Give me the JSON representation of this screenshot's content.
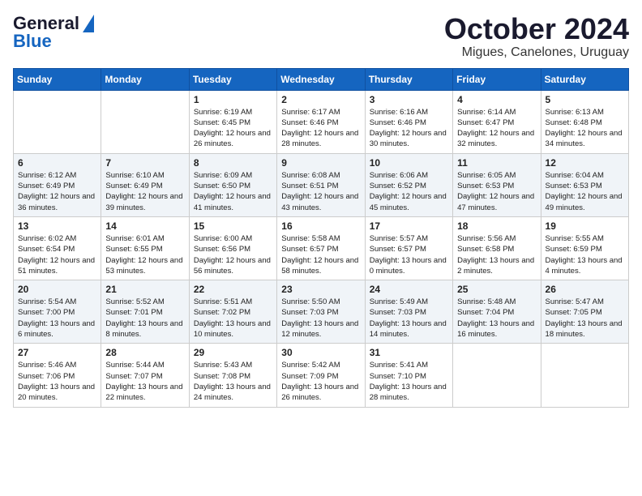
{
  "header": {
    "logo_general": "General",
    "logo_blue": "Blue",
    "month_title": "October 2024",
    "location": "Migues, Canelones, Uruguay"
  },
  "days_of_week": [
    "Sunday",
    "Monday",
    "Tuesday",
    "Wednesday",
    "Thursday",
    "Friday",
    "Saturday"
  ],
  "weeks": [
    [
      {
        "day": "",
        "sunrise": "",
        "sunset": "",
        "daylight": ""
      },
      {
        "day": "",
        "sunrise": "",
        "sunset": "",
        "daylight": ""
      },
      {
        "day": "1",
        "sunrise": "Sunrise: 6:19 AM",
        "sunset": "Sunset: 6:45 PM",
        "daylight": "Daylight: 12 hours and 26 minutes."
      },
      {
        "day": "2",
        "sunrise": "Sunrise: 6:17 AM",
        "sunset": "Sunset: 6:46 PM",
        "daylight": "Daylight: 12 hours and 28 minutes."
      },
      {
        "day": "3",
        "sunrise": "Sunrise: 6:16 AM",
        "sunset": "Sunset: 6:46 PM",
        "daylight": "Daylight: 12 hours and 30 minutes."
      },
      {
        "day": "4",
        "sunrise": "Sunrise: 6:14 AM",
        "sunset": "Sunset: 6:47 PM",
        "daylight": "Daylight: 12 hours and 32 minutes."
      },
      {
        "day": "5",
        "sunrise": "Sunrise: 6:13 AM",
        "sunset": "Sunset: 6:48 PM",
        "daylight": "Daylight: 12 hours and 34 minutes."
      }
    ],
    [
      {
        "day": "6",
        "sunrise": "Sunrise: 6:12 AM",
        "sunset": "Sunset: 6:49 PM",
        "daylight": "Daylight: 12 hours and 36 minutes."
      },
      {
        "day": "7",
        "sunrise": "Sunrise: 6:10 AM",
        "sunset": "Sunset: 6:49 PM",
        "daylight": "Daylight: 12 hours and 39 minutes."
      },
      {
        "day": "8",
        "sunrise": "Sunrise: 6:09 AM",
        "sunset": "Sunset: 6:50 PM",
        "daylight": "Daylight: 12 hours and 41 minutes."
      },
      {
        "day": "9",
        "sunrise": "Sunrise: 6:08 AM",
        "sunset": "Sunset: 6:51 PM",
        "daylight": "Daylight: 12 hours and 43 minutes."
      },
      {
        "day": "10",
        "sunrise": "Sunrise: 6:06 AM",
        "sunset": "Sunset: 6:52 PM",
        "daylight": "Daylight: 12 hours and 45 minutes."
      },
      {
        "day": "11",
        "sunrise": "Sunrise: 6:05 AM",
        "sunset": "Sunset: 6:53 PM",
        "daylight": "Daylight: 12 hours and 47 minutes."
      },
      {
        "day": "12",
        "sunrise": "Sunrise: 6:04 AM",
        "sunset": "Sunset: 6:53 PM",
        "daylight": "Daylight: 12 hours and 49 minutes."
      }
    ],
    [
      {
        "day": "13",
        "sunrise": "Sunrise: 6:02 AM",
        "sunset": "Sunset: 6:54 PM",
        "daylight": "Daylight: 12 hours and 51 minutes."
      },
      {
        "day": "14",
        "sunrise": "Sunrise: 6:01 AM",
        "sunset": "Sunset: 6:55 PM",
        "daylight": "Daylight: 12 hours and 53 minutes."
      },
      {
        "day": "15",
        "sunrise": "Sunrise: 6:00 AM",
        "sunset": "Sunset: 6:56 PM",
        "daylight": "Daylight: 12 hours and 56 minutes."
      },
      {
        "day": "16",
        "sunrise": "Sunrise: 5:58 AM",
        "sunset": "Sunset: 6:57 PM",
        "daylight": "Daylight: 12 hours and 58 minutes."
      },
      {
        "day": "17",
        "sunrise": "Sunrise: 5:57 AM",
        "sunset": "Sunset: 6:57 PM",
        "daylight": "Daylight: 13 hours and 0 minutes."
      },
      {
        "day": "18",
        "sunrise": "Sunrise: 5:56 AM",
        "sunset": "Sunset: 6:58 PM",
        "daylight": "Daylight: 13 hours and 2 minutes."
      },
      {
        "day": "19",
        "sunrise": "Sunrise: 5:55 AM",
        "sunset": "Sunset: 6:59 PM",
        "daylight": "Daylight: 13 hours and 4 minutes."
      }
    ],
    [
      {
        "day": "20",
        "sunrise": "Sunrise: 5:54 AM",
        "sunset": "Sunset: 7:00 PM",
        "daylight": "Daylight: 13 hours and 6 minutes."
      },
      {
        "day": "21",
        "sunrise": "Sunrise: 5:52 AM",
        "sunset": "Sunset: 7:01 PM",
        "daylight": "Daylight: 13 hours and 8 minutes."
      },
      {
        "day": "22",
        "sunrise": "Sunrise: 5:51 AM",
        "sunset": "Sunset: 7:02 PM",
        "daylight": "Daylight: 13 hours and 10 minutes."
      },
      {
        "day": "23",
        "sunrise": "Sunrise: 5:50 AM",
        "sunset": "Sunset: 7:03 PM",
        "daylight": "Daylight: 13 hours and 12 minutes."
      },
      {
        "day": "24",
        "sunrise": "Sunrise: 5:49 AM",
        "sunset": "Sunset: 7:03 PM",
        "daylight": "Daylight: 13 hours and 14 minutes."
      },
      {
        "day": "25",
        "sunrise": "Sunrise: 5:48 AM",
        "sunset": "Sunset: 7:04 PM",
        "daylight": "Daylight: 13 hours and 16 minutes."
      },
      {
        "day": "26",
        "sunrise": "Sunrise: 5:47 AM",
        "sunset": "Sunset: 7:05 PM",
        "daylight": "Daylight: 13 hours and 18 minutes."
      }
    ],
    [
      {
        "day": "27",
        "sunrise": "Sunrise: 5:46 AM",
        "sunset": "Sunset: 7:06 PM",
        "daylight": "Daylight: 13 hours and 20 minutes."
      },
      {
        "day": "28",
        "sunrise": "Sunrise: 5:44 AM",
        "sunset": "Sunset: 7:07 PM",
        "daylight": "Daylight: 13 hours and 22 minutes."
      },
      {
        "day": "29",
        "sunrise": "Sunrise: 5:43 AM",
        "sunset": "Sunset: 7:08 PM",
        "daylight": "Daylight: 13 hours and 24 minutes."
      },
      {
        "day": "30",
        "sunrise": "Sunrise: 5:42 AM",
        "sunset": "Sunset: 7:09 PM",
        "daylight": "Daylight: 13 hours and 26 minutes."
      },
      {
        "day": "31",
        "sunrise": "Sunrise: 5:41 AM",
        "sunset": "Sunset: 7:10 PM",
        "daylight": "Daylight: 13 hours and 28 minutes."
      },
      {
        "day": "",
        "sunrise": "",
        "sunset": "",
        "daylight": ""
      },
      {
        "day": "",
        "sunrise": "",
        "sunset": "",
        "daylight": ""
      }
    ]
  ]
}
